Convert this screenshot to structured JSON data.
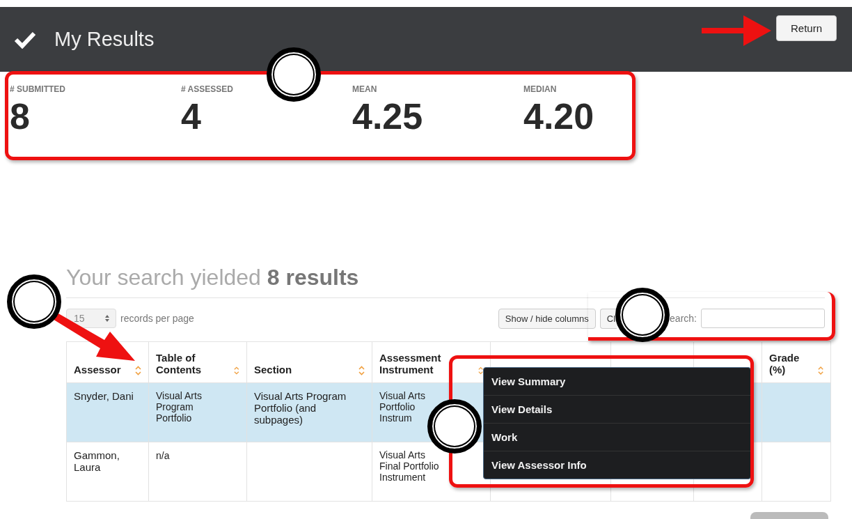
{
  "header": {
    "title": "My Results",
    "return_button": "Return"
  },
  "stats": [
    {
      "label": "# SUBMITTED",
      "value": "8"
    },
    {
      "label": "# ASSESSED",
      "value": "4"
    },
    {
      "label": "MEAN",
      "value": "4.25"
    },
    {
      "label": "MEDIAN",
      "value": "4.20"
    }
  ],
  "results_heading": "Your search yielded **8 results**",
  "toolbar": {
    "page_size": "15",
    "page_size_label": "records per page",
    "buttons": [
      "Show / hide columns",
      "Cl"
    ],
    "search_label": "earch:"
  },
  "table": {
    "columns": [
      {
        "label": "Assessor",
        "sort_icon": true
      },
      {
        "label": "Table of Contents",
        "sort_icon": true
      },
      {
        "label": "Section",
        "sort_icon": true
      },
      {
        "label": "Assessment Instrument",
        "sort_icon": true
      },
      {
        "sort_icon": false
      },
      {
        "sort_icon": false
      },
      {
        "sort_icon": false
      },
      {
        "label": "Grade (%)",
        "sort_icon": true
      }
    ],
    "rows": [
      {
        "selected": true,
        "assessor": "Snyder, Dani",
        "table_of_contents": "Visual Arts Program Portfolio",
        "section": "Visual Arts Program Portfolio (and subpages)",
        "assessment_instrument": "Visual Arts Portfolio Instrum"
      },
      {
        "selected": false,
        "assessor": "Gammon, Laura",
        "table_of_contents": "n/a",
        "assessment_instrument": "Visual Arts Final Portfolio Instrument"
      }
    ]
  },
  "context_menu": [
    "View Summary",
    "View Details",
    "Work",
    "View Assessor Info"
  ]
}
